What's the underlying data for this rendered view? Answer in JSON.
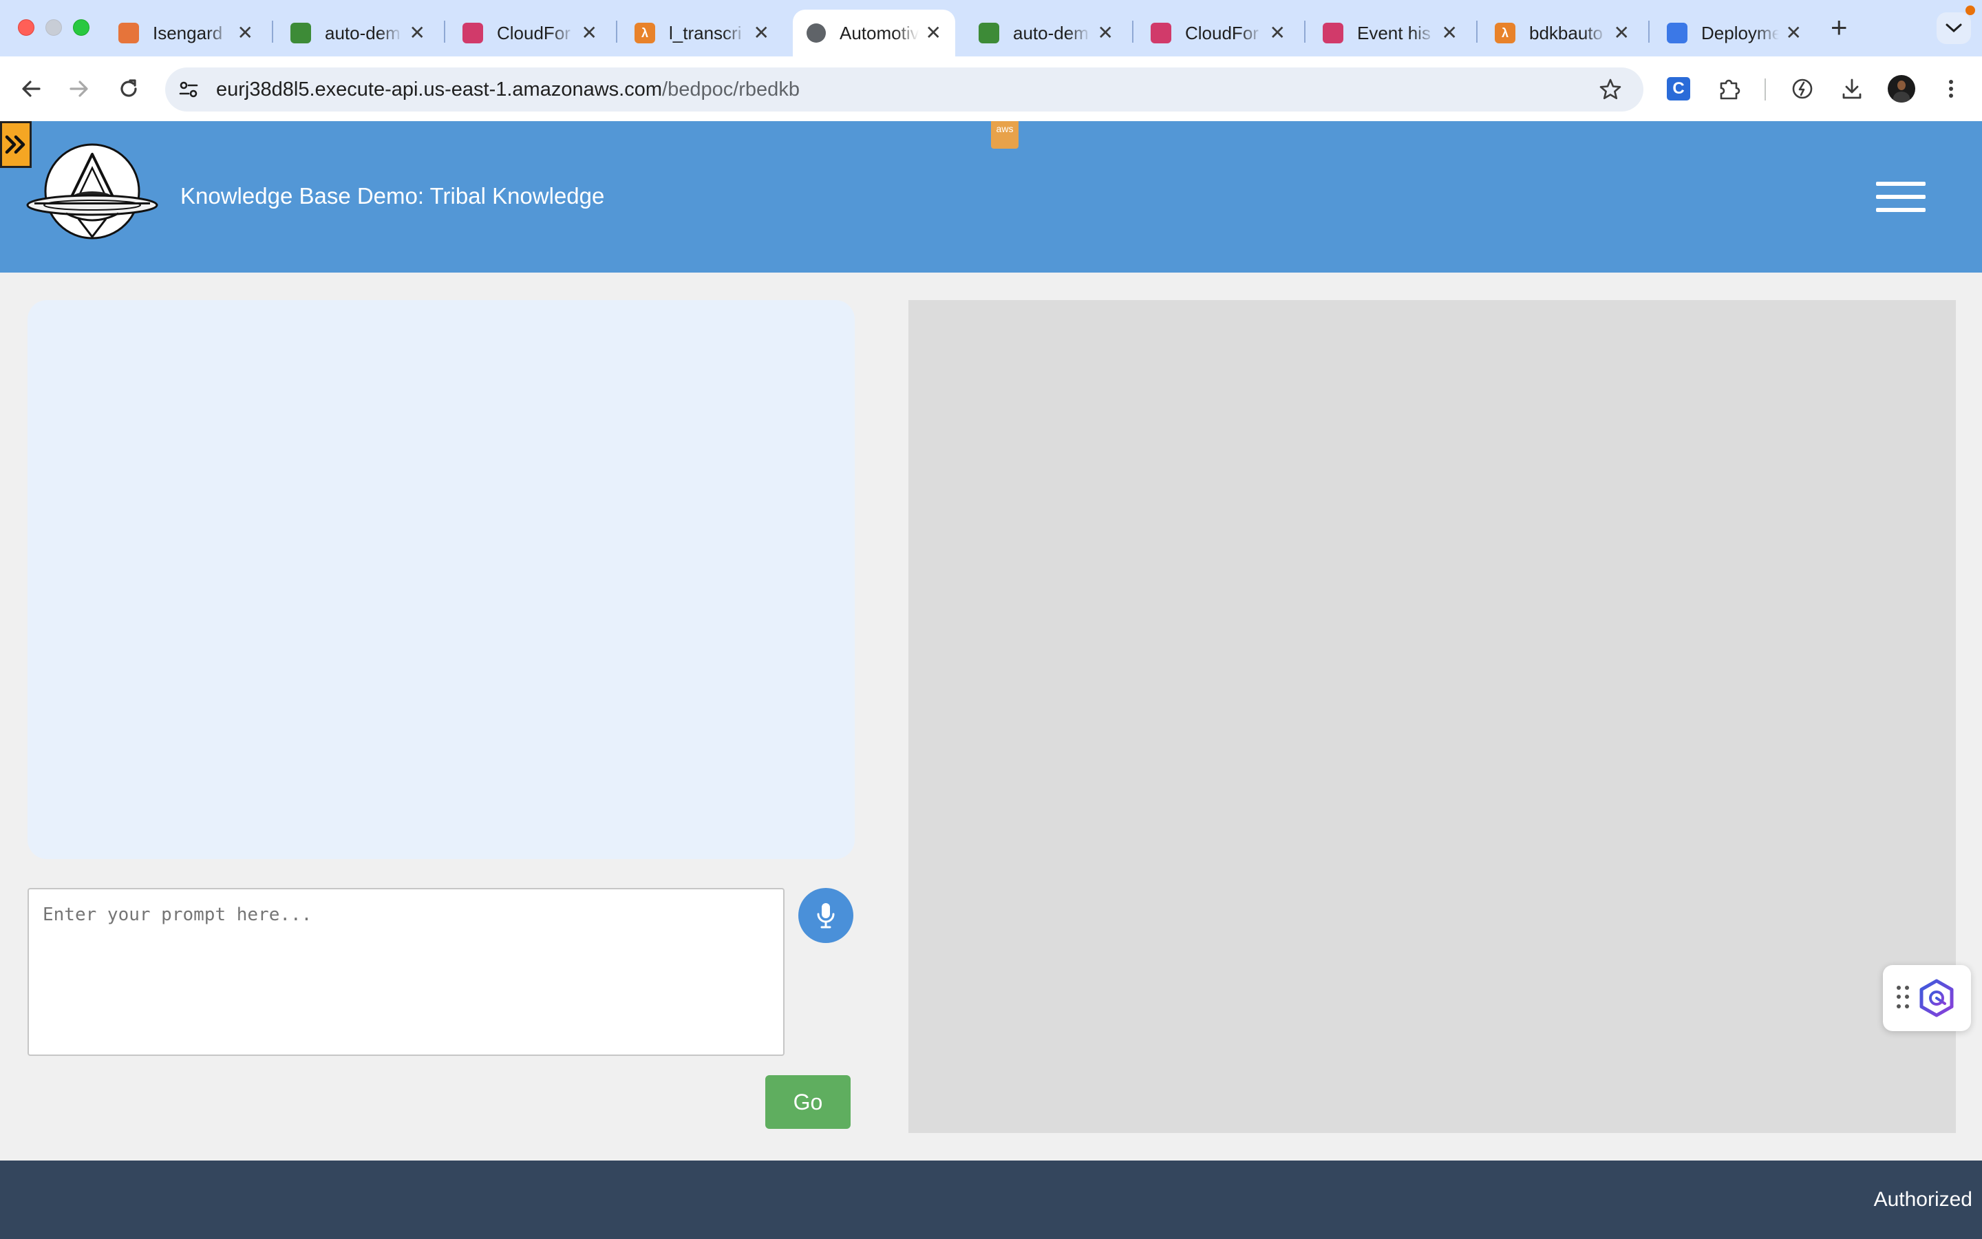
{
  "browser": {
    "tabs": [
      {
        "title": "Isengard",
        "favicon_color": "#e6743a",
        "favicon_glyph": "",
        "active": false
      },
      {
        "title": "auto-dem",
        "favicon_color": "#3d8b37",
        "favicon_glyph": "",
        "active": false
      },
      {
        "title": "CloudFor",
        "favicon_color": "#d13a6a",
        "favicon_glyph": "",
        "active": false
      },
      {
        "title": "l_transcri",
        "favicon_color": "#e8822a",
        "favicon_glyph": "λ",
        "active": false
      },
      {
        "title": "Automotiv",
        "favicon_color": "#5f6368",
        "favicon_glyph": "",
        "active": true
      },
      {
        "title": "auto-dem",
        "favicon_color": "#3d8b37",
        "favicon_glyph": "",
        "active": false
      },
      {
        "title": "CloudFor",
        "favicon_color": "#d13a6a",
        "favicon_glyph": "",
        "active": false
      },
      {
        "title": "Event his",
        "favicon_color": "#d13a6a",
        "favicon_glyph": "",
        "active": false
      },
      {
        "title": "bdkbauto",
        "favicon_color": "#e8822a",
        "favicon_glyph": "λ",
        "active": false
      },
      {
        "title": "Deployme",
        "favicon_color": "#3b78e7",
        "favicon_glyph": "",
        "active": false
      }
    ],
    "close_glyph": "✕",
    "new_tab_glyph": "+",
    "url_host": "eurj38d8l5.execute-api.us-east-1.amazonaws.com",
    "url_path": "/bedpoc/rbedkb",
    "extension_badge": "C"
  },
  "header": {
    "title": "Knowledge Base Demo: Tribal Knowledge",
    "aws_badge": "aws",
    "accent_color": "#5397d6",
    "sidebar_toggle_glyph": "»"
  },
  "chat": {
    "prompt_placeholder": "Enter your prompt here...",
    "prompt_value": "",
    "go_label": "Go"
  },
  "footer": {
    "text": "Authorized"
  }
}
